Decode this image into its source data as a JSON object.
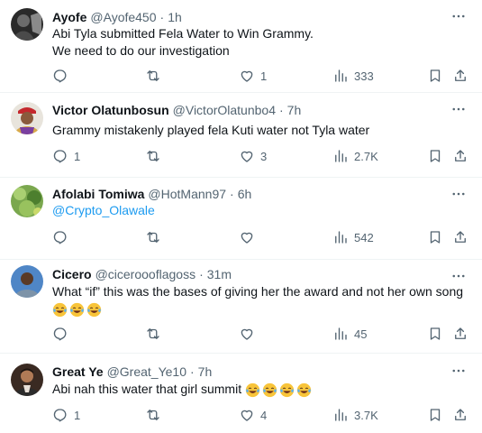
{
  "tweets": [
    {
      "name": "Ayofe",
      "handle": "@Ayofe450",
      "dot": "·",
      "time": "1h",
      "lines": [
        "Abi Tyla submitted Fela Water to Win Grammy.",
        "We need to do our investigation"
      ],
      "reply_count": "",
      "retweet_count": "",
      "like_count": "1",
      "view_count": "333"
    },
    {
      "name": "Victor Olatunbosun",
      "handle": "@VictorOlatunbo4",
      "dot": "·",
      "time": "7h",
      "lines": [
        "Grammy mistakenly played fela Kuti water not Tyla water"
      ],
      "reply_count": "1",
      "retweet_count": "",
      "like_count": "3",
      "view_count": "2.7K"
    },
    {
      "name": "Afolabi Tomiwa",
      "handle": "@HotMann97",
      "dot": "·",
      "time": "6h",
      "mention": "@Crypto_Olawale",
      "reply_count": "",
      "retweet_count": "",
      "like_count": "",
      "view_count": "542"
    },
    {
      "name": "Cicero",
      "handle": "@ciceroooflagoss",
      "dot": "·",
      "time": "31m",
      "lines": [
        "What “if” this was the bases of giving her the award and not her own song"
      ],
      "emoji_count": 3,
      "reply_count": "",
      "retweet_count": "",
      "like_count": "",
      "view_count": "45"
    },
    {
      "name": "Great Ye",
      "handle": "@Great_Ye10",
      "dot": "·",
      "time": "7h",
      "lines": [
        "Abi nah this water that girl summit"
      ],
      "emoji_count": 4,
      "reply_count": "1",
      "retweet_count": "",
      "like_count": "4",
      "view_count": "3.7K"
    }
  ],
  "icons": {
    "more": "more-horizontal-icon",
    "reply": "reply-icon",
    "retweet": "retweet-icon",
    "like": "heart-icon",
    "views": "views-chart-icon",
    "bookmark": "bookmark-icon",
    "share": "share-icon",
    "emoji": "face-with-tears-of-joy-emoji"
  },
  "colors": {
    "text": "#0f1419",
    "secondary": "#536471",
    "link": "#1d9bf0",
    "divider": "#eff3f4"
  }
}
